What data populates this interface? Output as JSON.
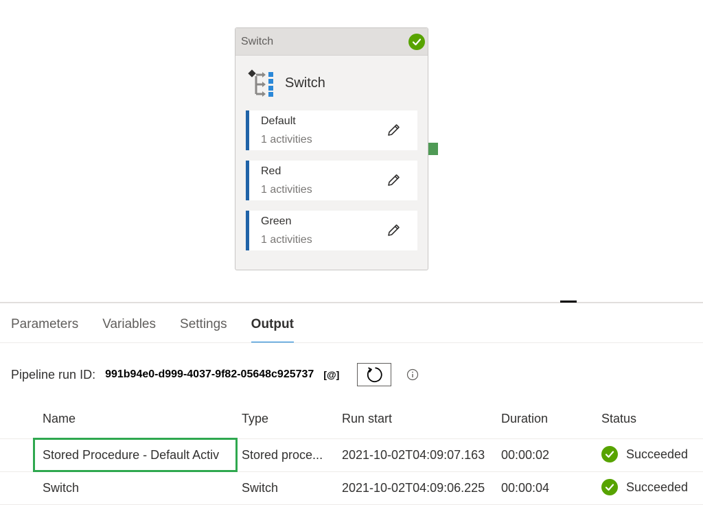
{
  "switch_card": {
    "header_label": "Switch",
    "title": "Switch",
    "cases": [
      {
        "name": "Default",
        "count": "1 activities"
      },
      {
        "name": "Red",
        "count": "1 activities"
      },
      {
        "name": "Green",
        "count": "1 activities"
      }
    ]
  },
  "tabs": [
    {
      "label": "Parameters",
      "active": false
    },
    {
      "label": "Variables",
      "active": false
    },
    {
      "label": "Settings",
      "active": false
    },
    {
      "label": "Output",
      "active": true
    }
  ],
  "pipeline_run": {
    "label": "Pipeline run ID:",
    "id": "991b94e0-d999-4037-9f82-05648c925737",
    "copy_label": "[@]"
  },
  "table": {
    "headers": [
      "Name",
      "Type",
      "Run start",
      "Duration",
      "Status"
    ],
    "rows": [
      {
        "name": "Stored Procedure - Default Activ",
        "type": "Stored proce...",
        "run_start": "2021-10-02T04:09:07.163",
        "duration": "00:00:02",
        "status": "Succeeded"
      },
      {
        "name": "Switch",
        "type": "Switch",
        "run_start": "2021-10-02T04:09:06.225",
        "duration": "00:00:04",
        "status": "Succeeded"
      }
    ]
  },
  "colors": {
    "success": "#57a300",
    "accent": "#0078d4",
    "case_bar": "#2063a8",
    "highlight": "#2fa84f"
  }
}
